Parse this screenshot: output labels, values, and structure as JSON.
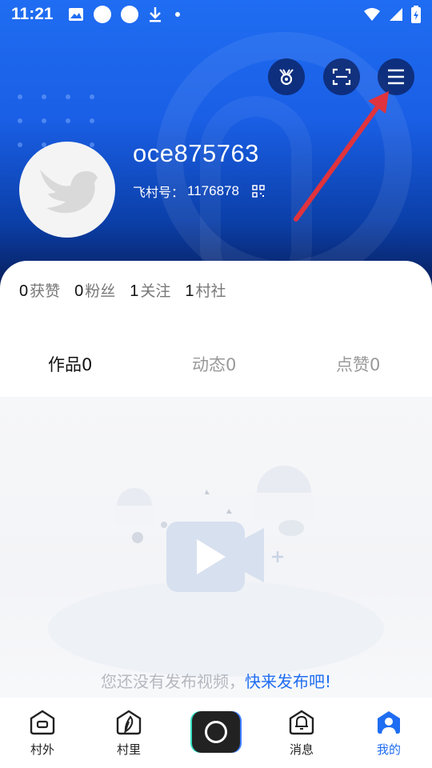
{
  "status_bar": {
    "time": "11:21"
  },
  "header": {
    "username": "oce875763",
    "village_number_label": "飞村号：",
    "village_number": "1176878"
  },
  "top_buttons": {
    "badge": "medal-icon",
    "scan": "scan-icon",
    "menu": "menu-icon"
  },
  "stats": [
    {
      "count": "0",
      "label": "获赞"
    },
    {
      "count": "0",
      "label": "粉丝"
    },
    {
      "count": "1",
      "label": "关注"
    },
    {
      "count": "1",
      "label": "村社"
    }
  ],
  "tabs": [
    {
      "label": "作品0",
      "active": true
    },
    {
      "label": "动态0",
      "active": false
    },
    {
      "label": "点赞0",
      "active": false
    }
  ],
  "empty_state": {
    "text": "您还没有发布视频，",
    "link": "快来发布吧!"
  },
  "bottom_nav": [
    {
      "label": "村外",
      "icon": "home-icon",
      "active": false
    },
    {
      "label": "村里",
      "icon": "feather-icon",
      "active": false
    },
    {
      "label": "",
      "icon": "publish-icon",
      "active": false
    },
    {
      "label": "消息",
      "icon": "bell-icon",
      "active": false
    },
    {
      "label": "我的",
      "icon": "profile-icon",
      "active": true
    }
  ],
  "colors": {
    "accent": "#1f6df2",
    "header_top": "#1f6df2",
    "header_bottom": "#07194f",
    "annotation_arrow": "#e0333d"
  }
}
